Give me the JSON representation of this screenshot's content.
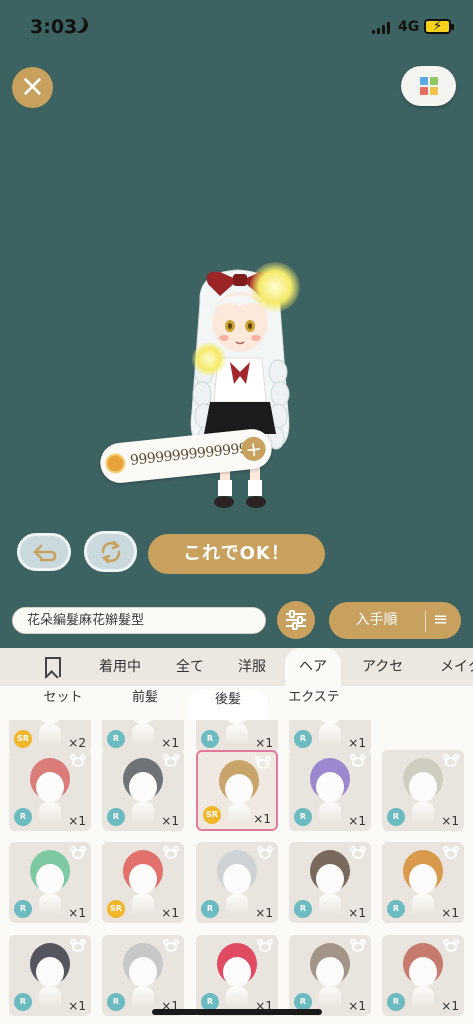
{
  "status": {
    "time": "3:03",
    "network": "4G"
  },
  "coins": {
    "amount": "99999999999999"
  },
  "actions": {
    "ok_label": "これでOK！"
  },
  "search": {
    "value": "花朵編髮麻花辮髮型"
  },
  "sort": {
    "label": "入手順"
  },
  "category_tabs": [
    {
      "label": "着用中"
    },
    {
      "label": "全て"
    },
    {
      "label": "洋服"
    },
    {
      "label": "ヘア",
      "active": true
    },
    {
      "label": "アクセ"
    },
    {
      "label": "メイク"
    }
  ],
  "sub_tabs": [
    {
      "label": "セット"
    },
    {
      "label": "前髪"
    },
    {
      "label": "後髪",
      "active": true
    },
    {
      "label": "エクステ"
    }
  ],
  "grid": {
    "partial_row": [
      {
        "rarity": "SR",
        "qty": "×2"
      },
      {
        "rarity": "R",
        "qty": "×1"
      },
      {
        "rarity": "R",
        "qty": "×1"
      },
      {
        "rarity": "R",
        "qty": "×1"
      }
    ],
    "rows": [
      [
        {
          "rarity": "R",
          "qty": "×1",
          "hair_color": "#d97c7a"
        },
        {
          "rarity": "R",
          "qty": "×1",
          "hair_color": "#6f7378"
        },
        {
          "rarity": "SR",
          "qty": "×1",
          "hair_color": "#c9a46a",
          "selected": true
        },
        {
          "rarity": "R",
          "qty": "×1",
          "hair_color": "#9c88cf"
        },
        {
          "rarity": "R",
          "qty": "×1",
          "hair_color": "#cfcdc0"
        }
      ],
      [
        {
          "rarity": "R",
          "qty": "×1",
          "hair_color": "#7dc9a3"
        },
        {
          "rarity": "SR",
          "qty": "×1",
          "hair_color": "#e2716e"
        },
        {
          "rarity": "R",
          "qty": "×1",
          "hair_color": "#cfd2d4"
        },
        {
          "rarity": "R",
          "qty": "×1",
          "hair_color": "#7a6a5e"
        },
        {
          "rarity": "R",
          "qty": "×1",
          "hair_color": "#d99a4e"
        }
      ],
      [
        {
          "rarity": "R",
          "qty": "×1",
          "hair_color": "#55555f"
        },
        {
          "rarity": "R",
          "qty": "×1",
          "hair_color": "#c8c8c8"
        },
        {
          "rarity": "R",
          "qty": "×1",
          "hair_color": "#e04a62"
        },
        {
          "rarity": "R",
          "qty": "×1",
          "hair_color": "#a39488"
        },
        {
          "rarity": "R",
          "qty": "×1",
          "hair_color": "#c67b6e"
        }
      ]
    ]
  },
  "colors": {
    "accent": "#c8a15e",
    "background": "#3d6262",
    "panel": "#ece7e0",
    "selected_border": "#e27a9c"
  }
}
